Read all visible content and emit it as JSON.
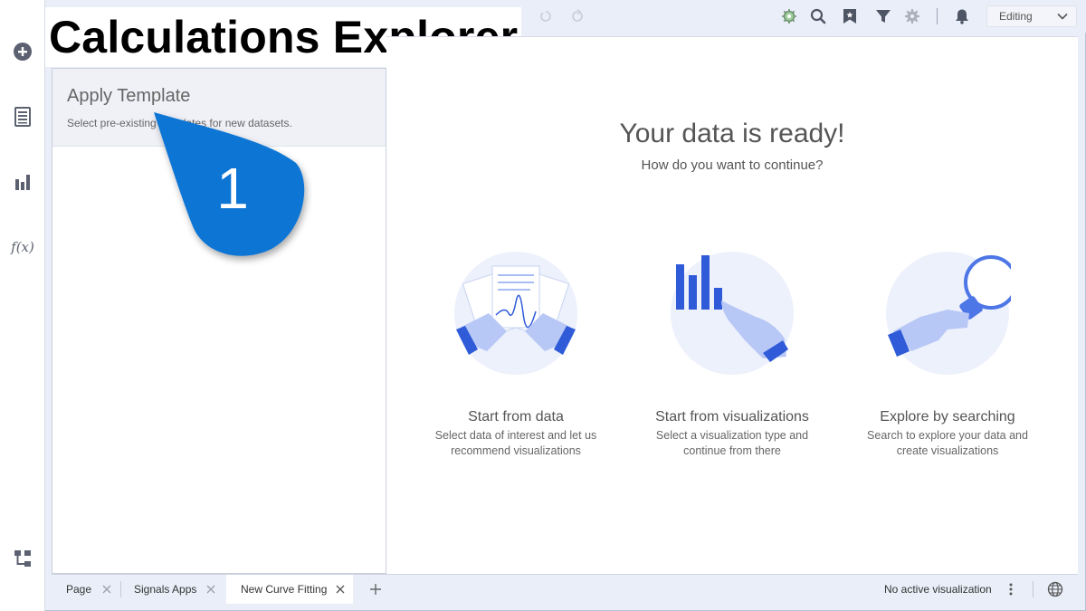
{
  "overlay_title": "Calculations Explorer",
  "topbar": {
    "mode_select": "Editing"
  },
  "left_panel": {
    "template_card": {
      "title": "Apply Template",
      "description": "Select pre-existing templates for new datasets."
    }
  },
  "main": {
    "title": "Your data is ready!",
    "subtitle": "How do you want to continue?",
    "options": [
      {
        "title": "Start from data",
        "desc_line1": "Select data of interest and let us",
        "desc_line2": "recommend visualizations"
      },
      {
        "title": "Start from visualizations",
        "desc_line1": "Select a visualization type and",
        "desc_line2": "continue from there"
      },
      {
        "title": "Explore by searching",
        "desc_line1": "Search to explore your data and",
        "desc_line2": "create visualizations"
      }
    ]
  },
  "bottombar": {
    "tabs": [
      {
        "label": "Page"
      },
      {
        "label": "Signals Apps"
      },
      {
        "label": "New Curve Fitting"
      }
    ],
    "status": "No active visualization"
  },
  "callout": {
    "number": "1",
    "color": "#0a74d4"
  },
  "colors": {
    "accent": "#2f5bd8",
    "accent_light": "#a9bdf5",
    "circle_bg": "#edf1fc"
  }
}
